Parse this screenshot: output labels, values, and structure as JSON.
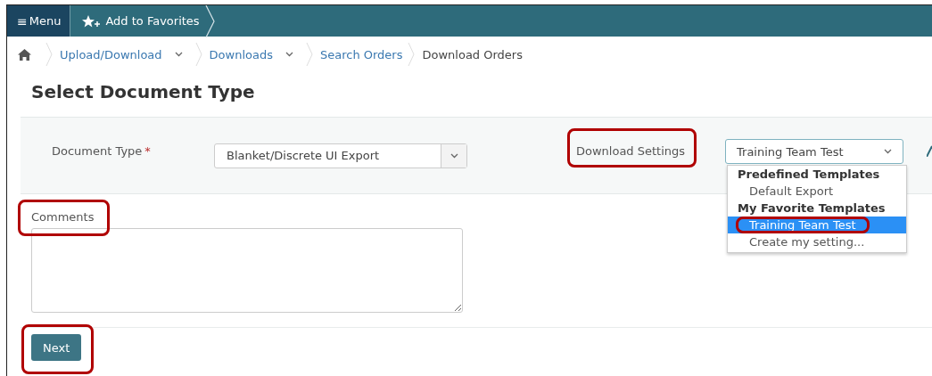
{
  "top_bar": {
    "menu": {
      "icon": "≡",
      "label": "Menu"
    },
    "favorites": {
      "label": "Add to Favorites"
    }
  },
  "breadcrumb": [
    {
      "label": "Upload/Download",
      "link": true,
      "caret": true
    },
    {
      "label": "Downloads",
      "link": true,
      "caret": true
    },
    {
      "label": "Search Orders",
      "link": true,
      "caret": false
    },
    {
      "label": "Download Orders",
      "link": false,
      "caret": false
    }
  ],
  "title": "Select Document Type",
  "document_type": {
    "label": "Document Type",
    "required": "*",
    "value": "Blanket/Discrete UI Export"
  },
  "download_settings": {
    "label": "Download Settings",
    "value": "Training Team Test",
    "highlighted": true,
    "dropdown": [
      {
        "kind": "group",
        "label": "Predefined Templates"
      },
      {
        "kind": "option",
        "label": "Default Export",
        "selected": false
      },
      {
        "kind": "group",
        "label": "My Favorite Templates"
      },
      {
        "kind": "option",
        "label": "Training Team Test",
        "selected": true,
        "highlighted": true
      },
      {
        "kind": "option",
        "label": "Create my setting...",
        "selected": false
      }
    ]
  },
  "comments": {
    "label": "Comments",
    "highlighted": true
  },
  "next_button": {
    "label": "Next",
    "highlighted": true
  }
}
